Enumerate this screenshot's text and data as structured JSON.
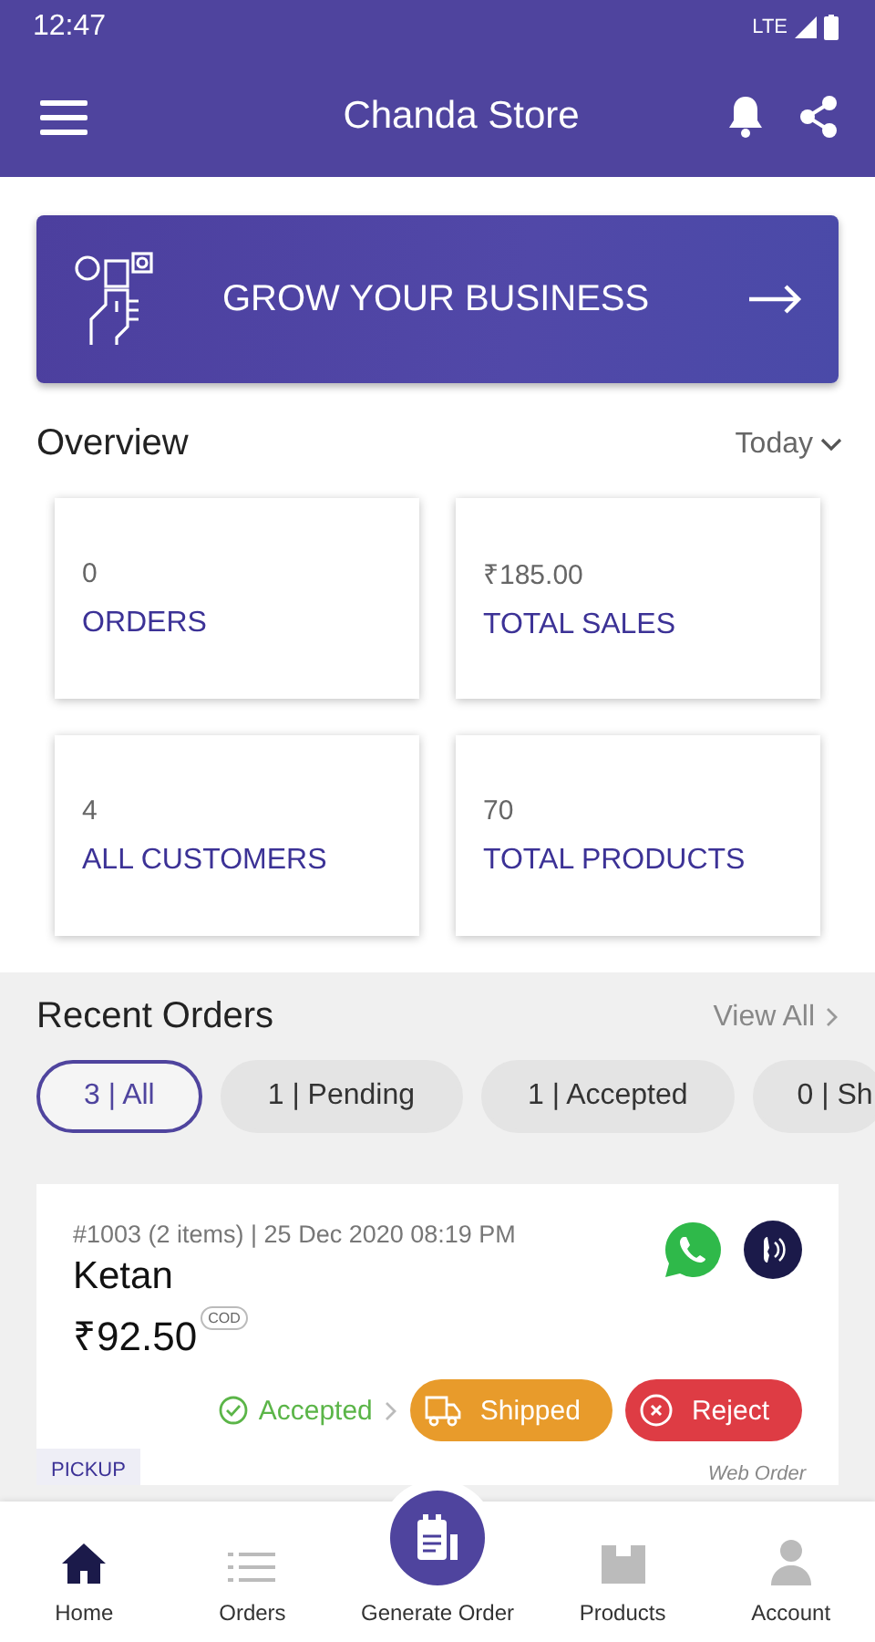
{
  "status_bar": {
    "time": "12:47",
    "network": "LTE"
  },
  "app_bar": {
    "title": "Chanda Store"
  },
  "banner": {
    "label": "GROW YOUR BUSINESS"
  },
  "overview": {
    "title": "Overview",
    "period": "Today",
    "stats": [
      {
        "value": "0",
        "label": "ORDERS"
      },
      {
        "value": "₹185.00",
        "label": "TOTAL SALES"
      },
      {
        "value": "4",
        "label": "ALL CUSTOMERS"
      },
      {
        "value": "70",
        "label": "TOTAL PRODUCTS"
      }
    ]
  },
  "recent_orders": {
    "title": "Recent Orders",
    "view_all": "View All",
    "filters": [
      {
        "label": "3 | All",
        "selected": true
      },
      {
        "label": "1 | Pending",
        "selected": false
      },
      {
        "label": "1 | Accepted",
        "selected": false
      },
      {
        "label": "0 | Sh",
        "selected": false
      }
    ],
    "order": {
      "meta": "#1003 (2 items) | 25 Dec 2020 08:19 PM",
      "customer": "Ketan",
      "amount": "₹92.50",
      "payment": "COD",
      "status": "Accepted",
      "next_action": "Shipped",
      "reject": "Reject",
      "delivery": "PICKUP",
      "source": "Web Order"
    }
  },
  "bottom_nav": [
    {
      "label": "Home",
      "kind": "tab",
      "selected": true
    },
    {
      "label": "Orders",
      "kind": "tab",
      "selected": false
    },
    {
      "label": "Generate Order",
      "kind": "fab",
      "selected": false
    },
    {
      "label": "Products",
      "kind": "tab",
      "selected": false
    },
    {
      "label": "Account",
      "kind": "tab",
      "selected": false
    }
  ]
}
